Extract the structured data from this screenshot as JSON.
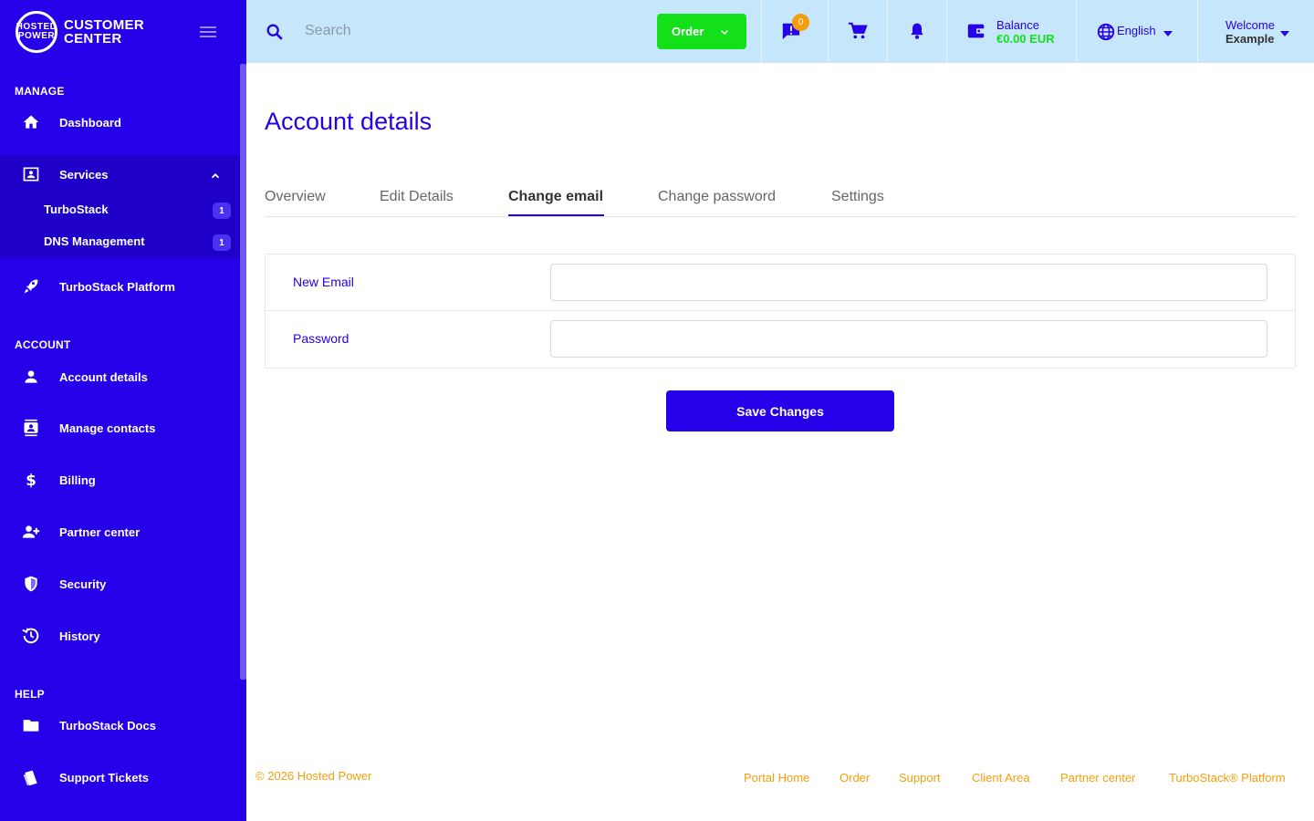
{
  "brand": {
    "logo_line1": "HOSTED",
    "logo_line2": "POWER",
    "title_line1": "CUSTOMER",
    "title_line2": "CENTER"
  },
  "sidebar": {
    "sections": {
      "manage": "MANAGE",
      "account": "ACCOUNT",
      "help": "HELP"
    },
    "items": {
      "dashboard": "Dashboard",
      "services": "Services",
      "turbostack": {
        "label": "TurboStack",
        "badge": "1"
      },
      "dns": {
        "label": "DNS Management",
        "badge": "1"
      },
      "platform": "TurboStack Platform",
      "account_details": "Account details",
      "manage_contacts": "Manage contacts",
      "billing": "Billing",
      "partner_center": "Partner center",
      "security": "Security",
      "history": "History",
      "docs": "TurboStack Docs",
      "support": "Support Tickets"
    }
  },
  "topbar": {
    "search_placeholder": "Search",
    "order_label": "Order",
    "ticket_count": "0",
    "balance_label": "Balance",
    "balance_value": "€0.00 EUR",
    "language": "English",
    "welcome_label": "Welcome",
    "welcome_name": "Example"
  },
  "main": {
    "title": "Account details",
    "tabs": [
      "Overview",
      "Edit Details",
      "Change email",
      "Change password",
      "Settings"
    ],
    "active_tab": "Change email",
    "form": {
      "new_email_label": "New Email",
      "password_label": "Password",
      "new_email_value": "",
      "password_value": ""
    },
    "save_label": "Save Changes"
  },
  "footer": {
    "copyright": "© 2026 Hosted Power",
    "links": [
      "Portal Home",
      "Order",
      "Support",
      "Client Area",
      "Partner center",
      "TurboStack® Platform"
    ]
  },
  "colors": {
    "primary": "#2600e8",
    "topbar": "#c6e6fb",
    "accent_green": "#14e01a",
    "accent_orange": "#f59e0b"
  }
}
